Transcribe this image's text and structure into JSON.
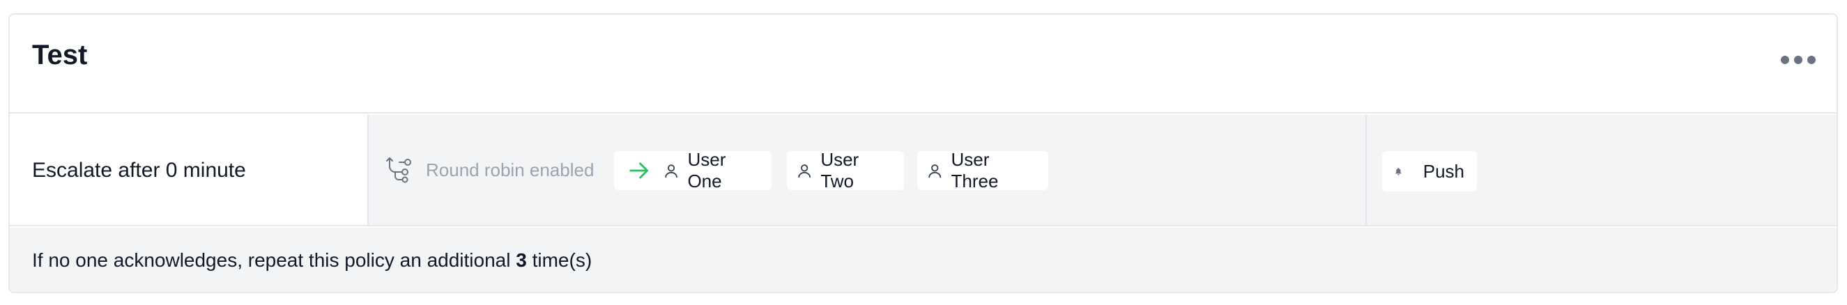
{
  "policy": {
    "title": "Test",
    "more_menu_icon": "more-horizontal-icon"
  },
  "rule": {
    "escalate_label": "Escalate after 0 minute",
    "round_robin_icon": "round-robin-icon",
    "round_robin_label": "Round robin enabled",
    "targets": [
      {
        "name": "User One",
        "icon": "user-icon",
        "current": true,
        "current_icon": "arrow-right-icon"
      },
      {
        "name": "User Two",
        "icon": "user-icon"
      },
      {
        "name": "User Three",
        "icon": "user-icon"
      }
    ],
    "notification": {
      "label": "Push",
      "icon": "bell-icon"
    }
  },
  "footer": {
    "repeat_prefix": "If no one acknowledges, repeat this policy an additional",
    "repeat_count": "3",
    "repeat_suffix": "time(s)"
  },
  "colors": {
    "border": "#e5e7eb",
    "row_background": "#f3f4f6",
    "muted_text": "#9ca3af",
    "current_arrow": "#22c55e",
    "icon_gray": "#6b7280"
  }
}
